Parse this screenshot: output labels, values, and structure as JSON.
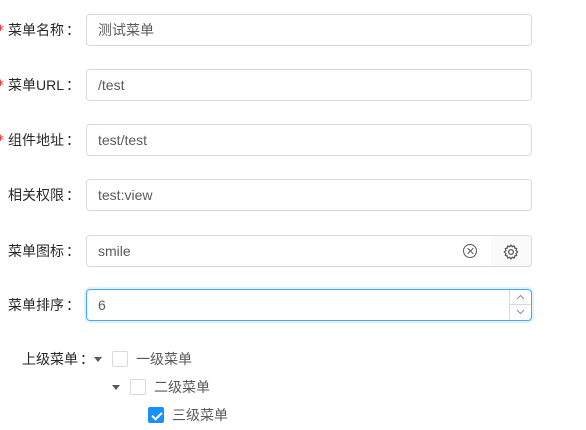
{
  "colors": {
    "required": "#f5222d",
    "primary": "#1890ff",
    "border": "#d9d9d9",
    "focus_border": "#40a9ff"
  },
  "fields": {
    "menu_name": {
      "required": true,
      "label": "菜单名称",
      "value": "测试菜单"
    },
    "menu_url": {
      "required": true,
      "label": "菜单URL",
      "value": "/test"
    },
    "component_path": {
      "required": true,
      "label": "组件地址",
      "value": "test/test"
    },
    "permission": {
      "required": false,
      "label": "相关权限",
      "value": "test:view"
    },
    "menu_icon": {
      "required": false,
      "label": "菜单图标",
      "value": "smile",
      "clear_icon": "close-circle-icon",
      "addon_icon": "setting-icon"
    },
    "menu_sort": {
      "required": false,
      "label": "菜单排序",
      "value": "6",
      "focused": true
    }
  },
  "parent_menu": {
    "label": "上级菜单",
    "tree": [
      {
        "title": "一级菜单",
        "expanded": true,
        "checked": false,
        "level": 1
      },
      {
        "title": "二级菜单",
        "expanded": true,
        "checked": false,
        "level": 2
      },
      {
        "title": "三级菜单",
        "expanded": false,
        "checked": true,
        "level": 3
      }
    ]
  },
  "colon": "："
}
